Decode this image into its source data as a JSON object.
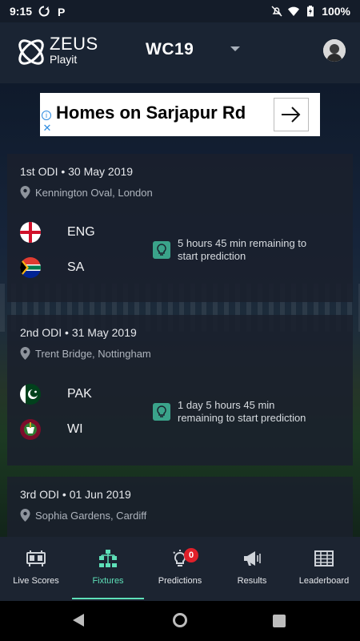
{
  "status_bar": {
    "time": "9:15",
    "battery": "100%"
  },
  "header": {
    "logo_line1": "ZEUS",
    "logo_line2": "Playit",
    "tournament": "WC19"
  },
  "ad": {
    "text": "Homes on Sarjapur Rd",
    "info_glyph": "i",
    "close_glyph": "✕"
  },
  "matches": [
    {
      "title": "1st ODI • 30 May 2019",
      "venue": "Kennington Oval, London",
      "team1": "ENG",
      "team2": "SA",
      "prediction": "5 hours 45 min remaining to start prediction"
    },
    {
      "title": "2nd ODI • 31 May 2019",
      "venue": "Trent Bridge, Nottingham",
      "team1": "PAK",
      "team2": "WI",
      "prediction": "1 day 5 hours 45 min remaining to start prediction"
    },
    {
      "title": "3rd ODI • 01 Jun 2019",
      "venue": "Sophia Gardens, Cardiff"
    }
  ],
  "nav": {
    "items": [
      {
        "label": "Live Scores",
        "icon": "scoreboard-icon"
      },
      {
        "label": "Fixtures",
        "icon": "bracket-icon"
      },
      {
        "label": "Predictions",
        "icon": "lightbulb-icon",
        "badge": "0"
      },
      {
        "label": "Results",
        "icon": "megaphone-icon"
      },
      {
        "label": "Leaderboard",
        "icon": "grid-table-icon"
      }
    ],
    "active_index": 1
  },
  "colors": {
    "accent": "#5ee0b8",
    "badge": "#e0202a",
    "card_bg": "#1a202c",
    "header_bg": "#1a2433"
  }
}
